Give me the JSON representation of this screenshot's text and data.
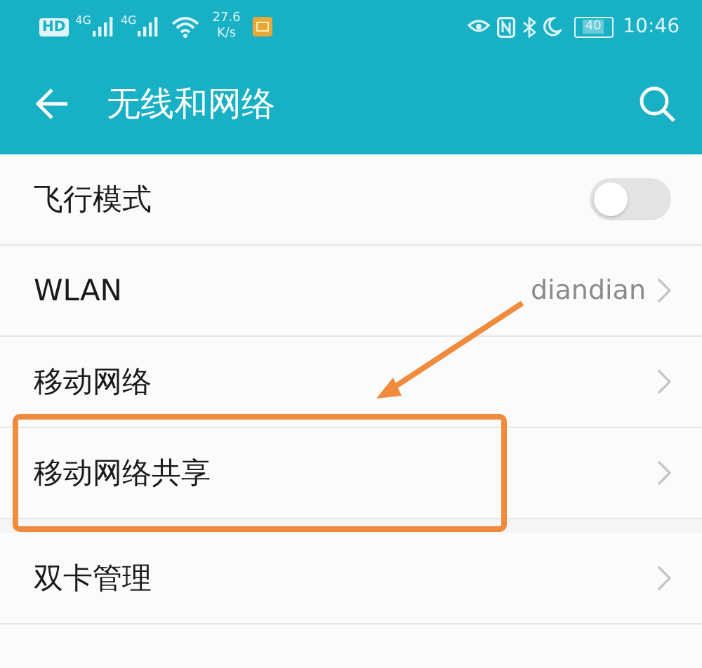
{
  "status_bar": {
    "hd": "HD",
    "signals": [
      "4G",
      "4G"
    ],
    "speed": "27.6",
    "speed_unit": "K/s",
    "battery": "40",
    "time": "10:46"
  },
  "header": {
    "title": "无线和网络"
  },
  "sections": [
    {
      "items": [
        {
          "kind": "toggle",
          "label": "飞行模式",
          "on": false
        },
        {
          "kind": "link",
          "label": "WLAN",
          "value": "diandian"
        },
        {
          "kind": "link",
          "label": "移动网络"
        },
        {
          "kind": "link",
          "label": "移动网络共享"
        }
      ]
    },
    {
      "items": [
        {
          "kind": "link",
          "label": "双卡管理"
        }
      ]
    }
  ]
}
